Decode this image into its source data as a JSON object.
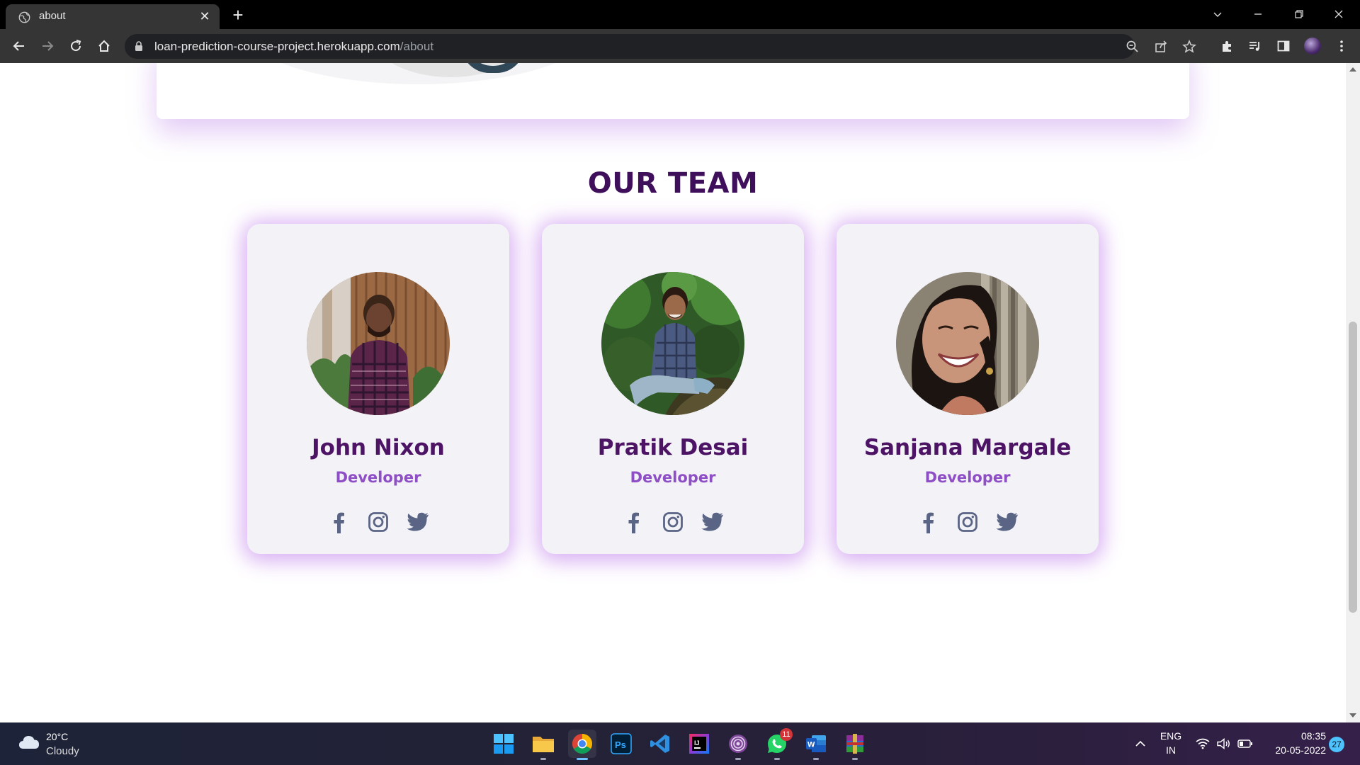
{
  "browser": {
    "tab_title": "about",
    "url_host": "loan-prediction-course-project.herokuapp.com",
    "url_path": "/about"
  },
  "page": {
    "section_title": "OUR TEAM",
    "members": [
      {
        "name": "John Nixon",
        "role": "Developer"
      },
      {
        "name": "Pratik Desai",
        "role": "Developer"
      },
      {
        "name": "Sanjana Margale",
        "role": "Developer"
      }
    ],
    "social_icons": [
      "facebook-icon",
      "instagram-icon",
      "twitter-icon"
    ]
  },
  "taskbar": {
    "weather_temp": "20°C",
    "weather_condition": "Cloudy",
    "whatsapp_badge": "11",
    "language": "ENG",
    "region": "IN",
    "time": "08:35",
    "date": "20-05-2022",
    "notification_count": "27"
  },
  "colors": {
    "title": "#3f0f5c",
    "name": "#4d1466",
    "role": "#8e4ec5",
    "card_bg": "#f2f2f7",
    "glow": "#be78eb"
  }
}
